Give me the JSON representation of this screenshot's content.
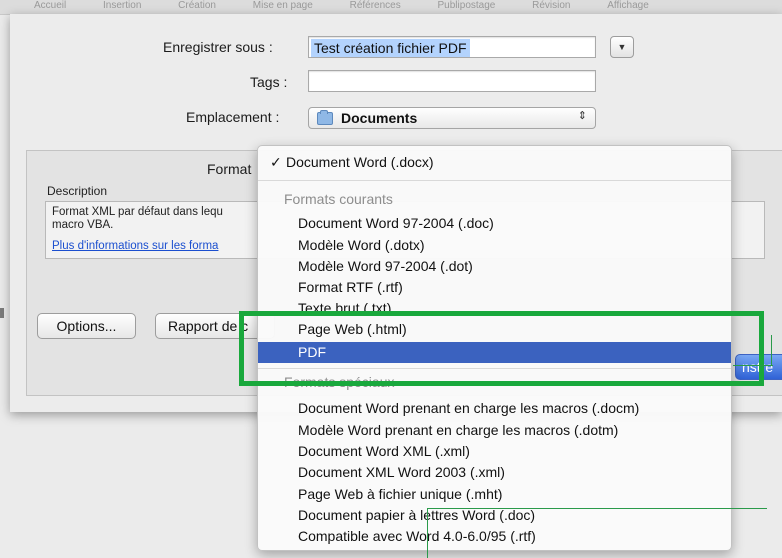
{
  "background_bar": [
    "Accueil",
    "Insertion",
    "Création",
    "Mise en page",
    "Références",
    "Publipostage",
    "Révision",
    "Affichage"
  ],
  "save_sheet": {
    "save_as_label": "Enregistrer sous :",
    "save_as_value": "Test création fichier PDF",
    "tags_label": "Tags :",
    "tags_value": "",
    "location_label": "Emplacement :",
    "location_value": "Documents",
    "format_label": "Format",
    "description_title": "Description",
    "description_text": "Format XML par défaut dans lequ",
    "description_text_2": "macro VBA.",
    "more_info_link": "Plus d'informations sur les forma",
    "options_button": "Options...",
    "report_button": "Rapport de c",
    "save_button": "nstre"
  },
  "format_menu": {
    "selected": "Document Word (.docx)",
    "checkmark": "✓",
    "groups": [
      {
        "title": "Formats courants",
        "items": [
          "Document Word 97-2004 (.doc)",
          "Modèle Word (.dotx)",
          "Modèle Word 97-2004 (.dot)",
          "Format RTF (.rtf)",
          "Texte brut (.txt)",
          "Page Web (.html)",
          "PDF"
        ]
      },
      {
        "title": "Formats spéciaux",
        "items": [
          "Document Word prenant en charge les macros (.docm)",
          "Modèle Word prenant en charge les macros (.dotm)",
          "Document Word XML (.xml)",
          "Document XML Word 2003 (.xml)",
          "Page Web à fichier unique (.mht)",
          "Document papier à lettres Word (.doc)",
          "Compatible avec Word 4.0-6.0/95 (.rtf)"
        ]
      }
    ],
    "highlighted_item": "PDF"
  },
  "colors": {
    "highlight": "#3b62bf",
    "annotation": "#19a83c",
    "link": "#1b4fcf"
  },
  "icons": {
    "folder": "folder-icon",
    "expand": "chevron-down-icon",
    "stepper": "up-down-arrows-icon",
    "check": "checkmark-icon"
  }
}
